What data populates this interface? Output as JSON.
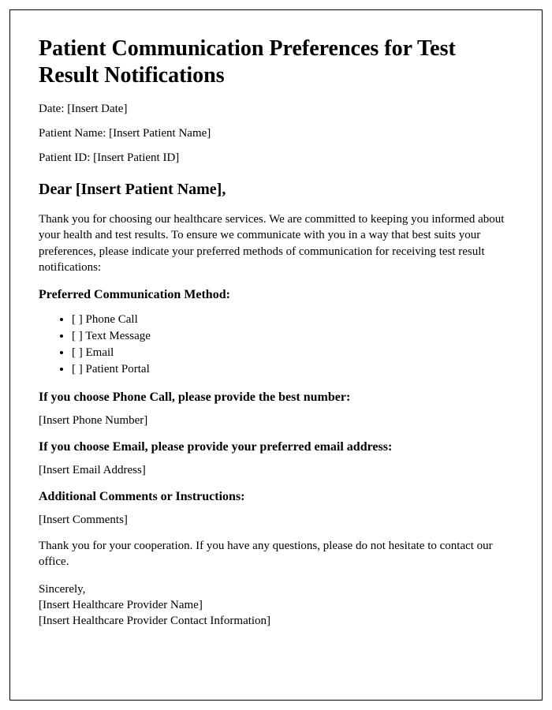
{
  "title": "Patient Communication Preferences for Test Result Notifications",
  "meta": {
    "date_label": "Date: ",
    "date_value": "[Insert Date]",
    "patient_name_label": "Patient Name: ",
    "patient_name_value": "[Insert Patient Name]",
    "patient_id_label": "Patient ID: ",
    "patient_id_value": "[Insert Patient ID]"
  },
  "salutation": "Dear [Insert Patient Name],",
  "intro": "Thank you for choosing our healthcare services. We are committed to keeping you informed about your health and test results. To ensure we communicate with you in a way that best suits your preferences, please indicate your preferred methods of communication for receiving test result notifications:",
  "sections": {
    "preferred_method_heading": "Preferred Communication Method:",
    "options": [
      "[ ] Phone Call",
      "[ ] Text Message",
      "[ ] Email",
      "[ ] Patient Portal"
    ],
    "phone_heading": "If you choose Phone Call, please provide the best number:",
    "phone_placeholder": "[Insert Phone Number]",
    "email_heading": "If you choose Email, please provide your preferred email address:",
    "email_placeholder": "[Insert Email Address]",
    "comments_heading": "Additional Comments or Instructions:",
    "comments_placeholder": "[Insert Comments]"
  },
  "thanks": "Thank you for your cooperation. If you have any questions, please do not hesitate to contact our office.",
  "closing": {
    "sincerely": "Sincerely,",
    "provider_name": "[Insert Healthcare Provider Name]",
    "provider_contact": "[Insert Healthcare Provider Contact Information]"
  }
}
